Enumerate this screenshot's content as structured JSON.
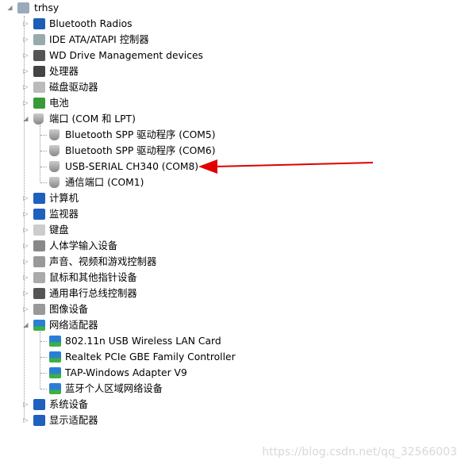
{
  "tree": {
    "root": {
      "label": "trhsy",
      "icon": "computer-icon"
    },
    "items": [
      {
        "label": "Bluetooth Radios",
        "icon": "bluetooth-icon",
        "color": "#1a5fb4",
        "expanded": false
      },
      {
        "label": "IDE ATA/ATAPI 控制器",
        "icon": "ide-controller-icon",
        "color": "#9aa",
        "expanded": false
      },
      {
        "label": "WD Drive Management devices",
        "icon": "wd-diamond-icon",
        "color": "#555",
        "expanded": false
      },
      {
        "label": "处理器",
        "icon": "processor-icon",
        "color": "#444",
        "expanded": false
      },
      {
        "label": "磁盘驱动器",
        "icon": "disk-drive-icon",
        "color": "#bbb",
        "expanded": false
      },
      {
        "label": "电池",
        "icon": "battery-icon",
        "color": "#3a9a3a",
        "expanded": false
      },
      {
        "label": "端口 (COM 和 LPT)",
        "icon": "port-icon",
        "color": "#aaa",
        "expanded": true,
        "children": [
          {
            "label": "Bluetooth SPP 驱动程序 (COM5)",
            "icon": "port-icon"
          },
          {
            "label": "Bluetooth SPP 驱动程序 (COM6)",
            "icon": "port-icon"
          },
          {
            "label": "USB-SERIAL CH340 (COM8)",
            "icon": "port-icon"
          },
          {
            "label": "通信端口 (COM1)",
            "icon": "port-icon"
          }
        ]
      },
      {
        "label": "计算机",
        "icon": "computer-monitor-icon",
        "color": "#1f5fbf",
        "expanded": false
      },
      {
        "label": "监视器",
        "icon": "monitor-icon",
        "color": "#1f5fbf",
        "expanded": false
      },
      {
        "label": "键盘",
        "icon": "keyboard-icon",
        "color": "#ccc",
        "expanded": false
      },
      {
        "label": "人体学输入设备",
        "icon": "hid-icon",
        "color": "#888",
        "expanded": false
      },
      {
        "label": "声音、视频和游戏控制器",
        "icon": "speaker-icon",
        "color": "#999",
        "expanded": false
      },
      {
        "label": "鼠标和其他指针设备",
        "icon": "mouse-icon",
        "color": "#aaa",
        "expanded": false
      },
      {
        "label": "通用串行总线控制器",
        "icon": "usb-plug-icon",
        "color": "#555",
        "expanded": false
      },
      {
        "label": "图像设备",
        "icon": "camera-icon",
        "color": "#999",
        "expanded": false
      },
      {
        "label": "网络适配器",
        "icon": "network-adapter-icon",
        "color": "#2a7fd4",
        "expanded": true,
        "children": [
          {
            "label": "802.11n USB Wireless LAN Card",
            "icon": "network-adapter-icon"
          },
          {
            "label": "Realtek PCIe GBE Family Controller",
            "icon": "network-adapter-icon"
          },
          {
            "label": "TAP-Windows Adapter V9",
            "icon": "network-adapter-icon"
          },
          {
            "label": "蓝牙个人区域网络设备",
            "icon": "network-adapter-icon"
          }
        ]
      },
      {
        "label": "系统设备",
        "icon": "system-device-icon",
        "color": "#1f5fbf",
        "expanded": false
      },
      {
        "label": "显示适配器",
        "icon": "display-adapter-icon",
        "color": "#1f5fbf",
        "expanded": false
      }
    ]
  },
  "annotation": {
    "arrow_color": "#e00000",
    "points_to": "USB-SERIAL CH340 (COM8)"
  },
  "watermark": "https://blog.csdn.net/qq_32566003"
}
